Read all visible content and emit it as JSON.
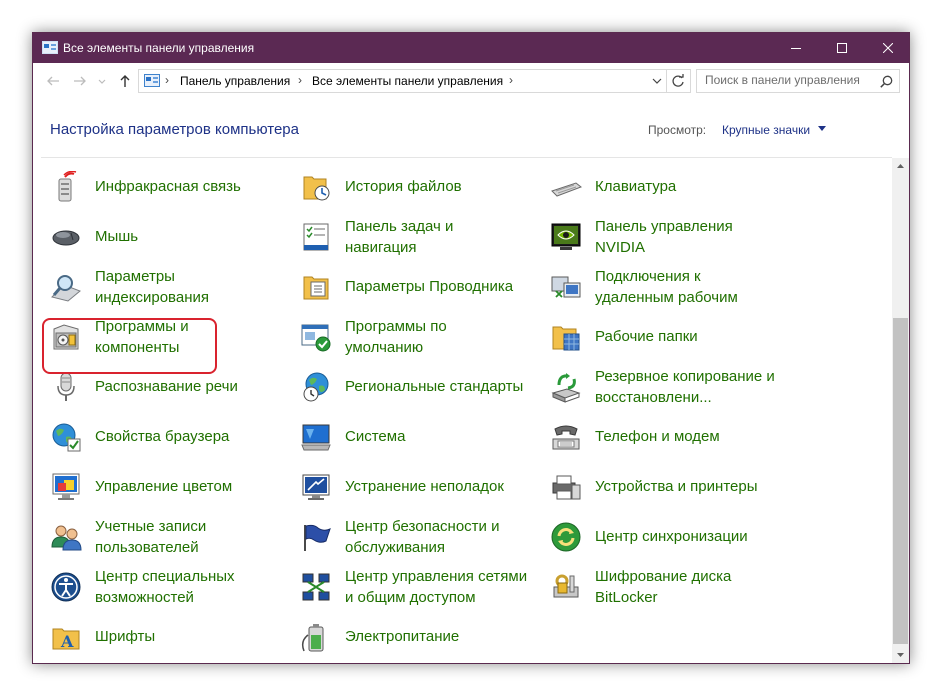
{
  "window": {
    "title": "Все элементы панели управления",
    "titlebar_color": "#5b2953",
    "buttons": [
      "minimize-icon",
      "maximize-icon",
      "close-icon"
    ]
  },
  "address_bar": {
    "breadcrumbs": [
      "Панель управления",
      "Все элементы панели управления"
    ],
    "separator": "›"
  },
  "search": {
    "placeholder": "Поиск в панели управления"
  },
  "header": {
    "title": "Настройка параметров компьютера",
    "view_by_label": "Просмотр:",
    "view_by_value": "Крупные значки"
  },
  "items": [
    {
      "label": "Инфракрасная связь",
      "icon": "infrared-icon"
    },
    {
      "label": "История файлов",
      "icon": "file-history-icon"
    },
    {
      "label": "Клавиатура",
      "icon": "keyboard-icon"
    },
    {
      "label": "Мышь",
      "icon": "mouse-icon"
    },
    {
      "label": "Панель задач и\nнавигация",
      "icon": "taskbar-icon"
    },
    {
      "label": "Панель управления\nNVIDIA",
      "icon": "nvidia-icon"
    },
    {
      "label": "Параметры\nиндексирования",
      "icon": "indexing-icon"
    },
    {
      "label": "Параметры Проводника",
      "icon": "explorer-options-icon"
    },
    {
      "label": "Подключения к\nудаленным рабочим",
      "icon": "remote-desktop-icon"
    },
    {
      "label": "Программы и\nкомпоненты",
      "icon": "programs-icon",
      "highlighted": true
    },
    {
      "label": "Программы по\nумолчанию",
      "icon": "default-programs-icon"
    },
    {
      "label": "Рабочие папки",
      "icon": "work-folders-icon"
    },
    {
      "label": "Распознавание речи",
      "icon": "microphone-icon"
    },
    {
      "label": "Региональные стандарты",
      "icon": "region-icon"
    },
    {
      "label": "Резервное копирование и\nвосстановлени...",
      "icon": "backup-icon"
    },
    {
      "label": "Свойства браузера",
      "icon": "internet-options-icon"
    },
    {
      "label": "Система",
      "icon": "system-icon"
    },
    {
      "label": "Телефон и модем",
      "icon": "phone-modem-icon"
    },
    {
      "label": "Управление цветом",
      "icon": "color-management-icon"
    },
    {
      "label": "Устранение неполадок",
      "icon": "troubleshooting-icon"
    },
    {
      "label": "Устройства и принтеры",
      "icon": "devices-printers-icon"
    },
    {
      "label": "Учетные записи\nпользователей",
      "icon": "user-accounts-icon"
    },
    {
      "label": "Центр безопасности и\nобслуживания",
      "icon": "security-flag-icon"
    },
    {
      "label": "Центр синхронизации",
      "icon": "sync-center-icon"
    },
    {
      "label": "Центр специальных\nвозможностей",
      "icon": "ease-of-access-icon"
    },
    {
      "label": "Центр управления сетями\nи общим доступом",
      "icon": "network-center-icon"
    },
    {
      "label": "Шифрование диска\nBitLocker",
      "icon": "bitlocker-icon"
    },
    {
      "label": "Шрифты",
      "icon": "fonts-icon"
    },
    {
      "label": "Электропитание",
      "icon": "power-options-icon"
    }
  ],
  "colors": {
    "link_green": "#207000",
    "heading_blue": "#1e3287",
    "highlight_red": "#d9232e"
  }
}
